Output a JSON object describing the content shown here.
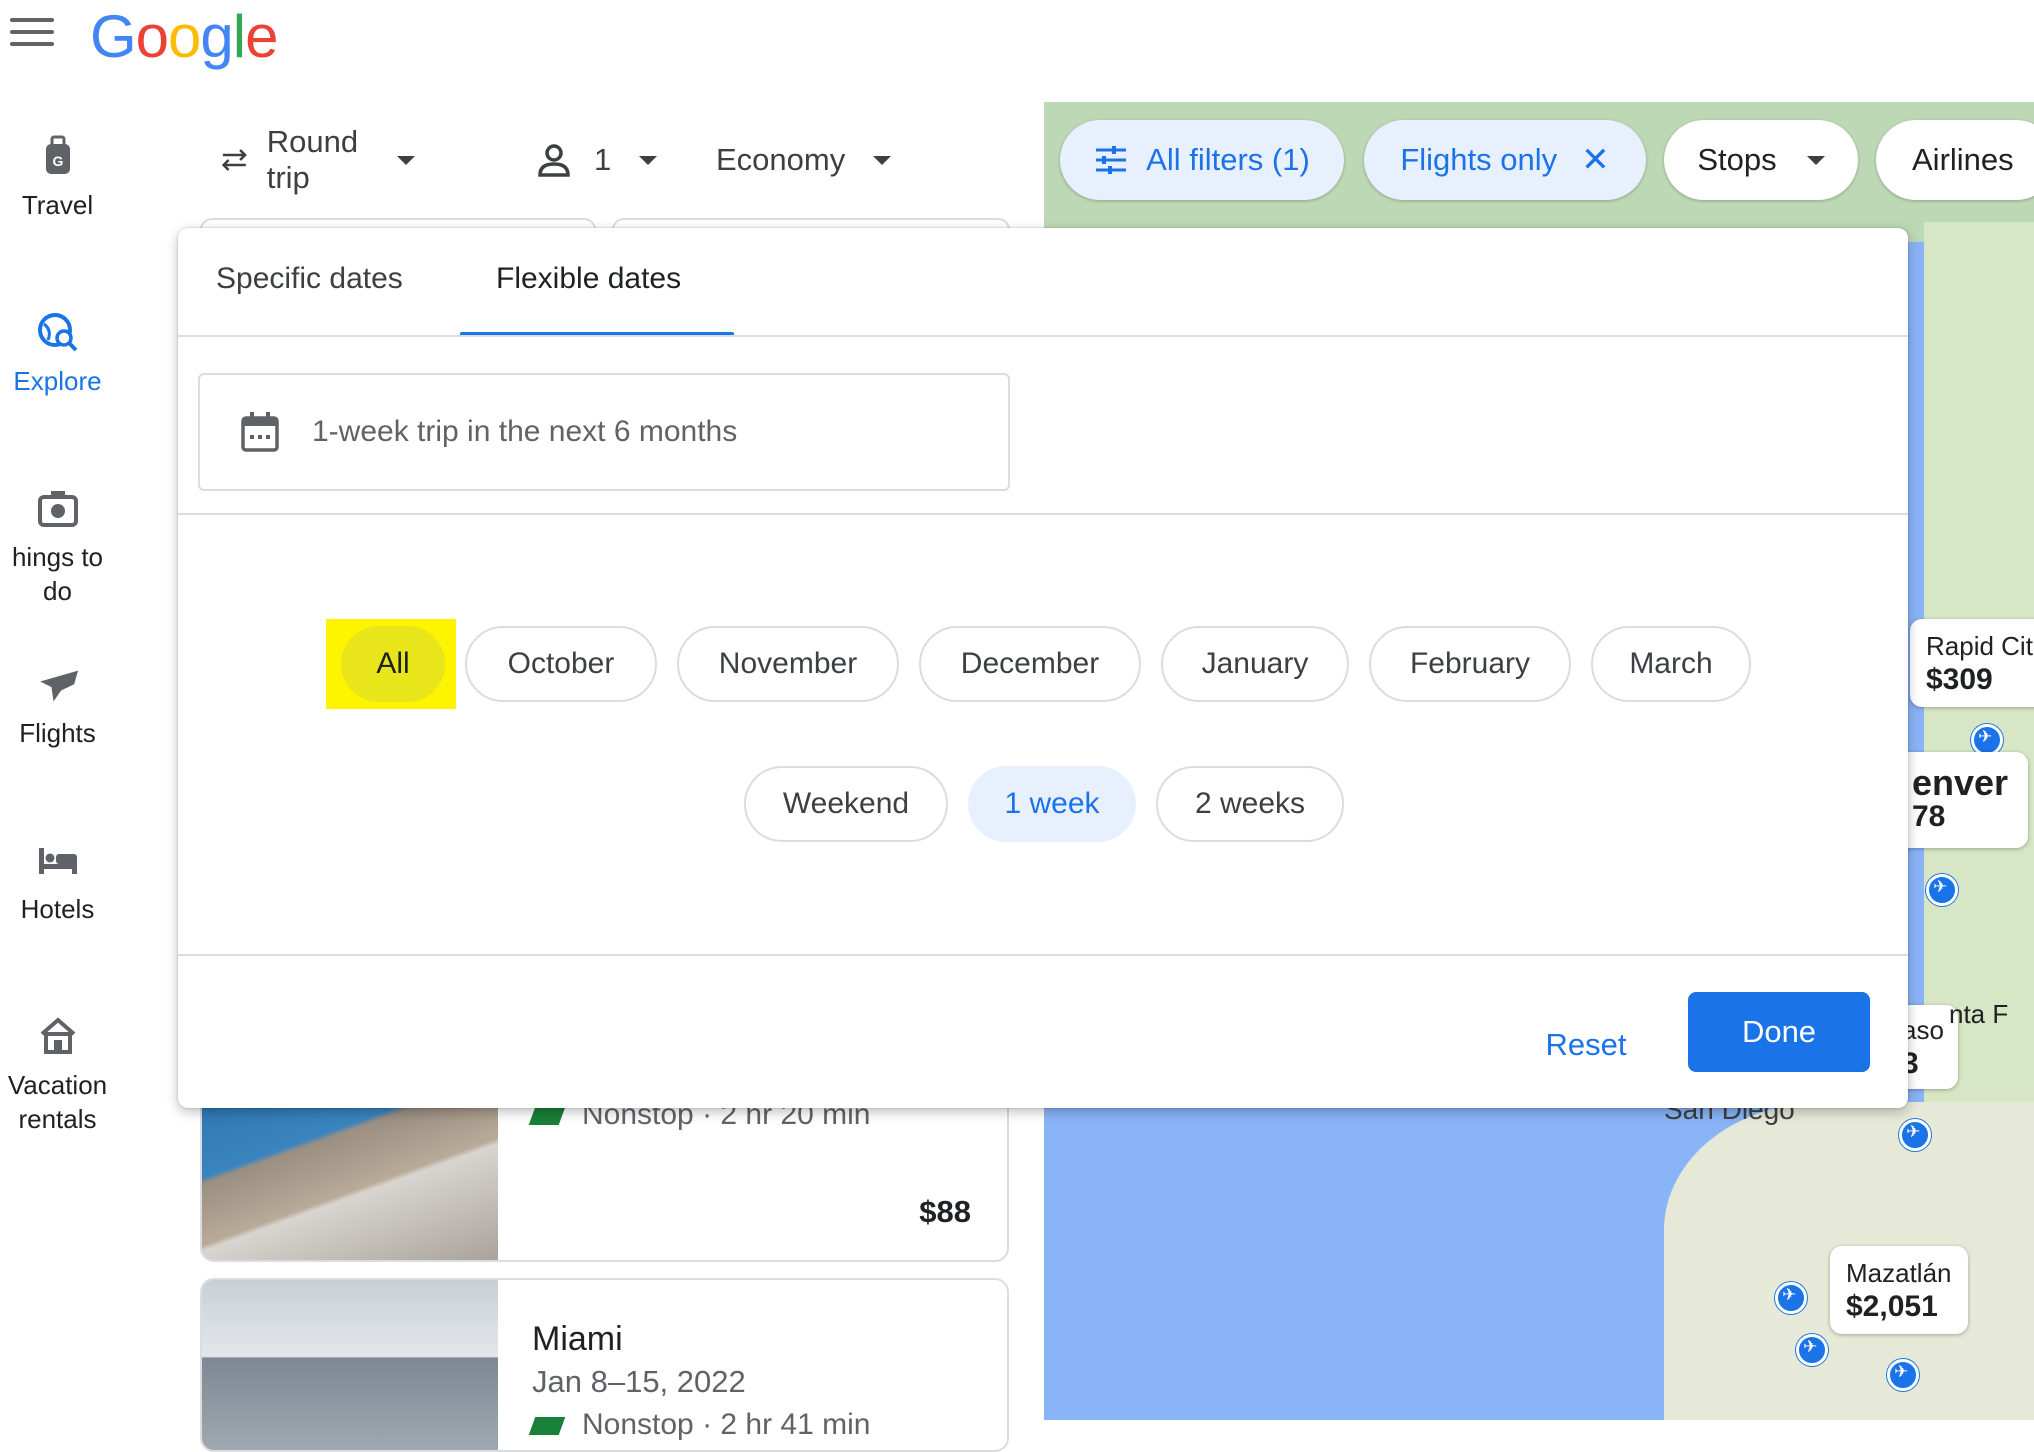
{
  "header": {
    "logo_letters": [
      "G",
      "o",
      "o",
      "g",
      "l",
      "e"
    ],
    "logo_colors": [
      "#4285f4",
      "#ea4335",
      "#fbbc05",
      "#4285f4",
      "#34a853",
      "#ea4335"
    ]
  },
  "rail": {
    "items": [
      {
        "label": "Travel",
        "icon": "luggage-icon"
      },
      {
        "label": "Explore",
        "icon": "explore-icon"
      },
      {
        "label": "hings to do",
        "icon": "camera-icon"
      },
      {
        "label": "Flights",
        "icon": "airplane-icon"
      },
      {
        "label": "Hotels",
        "icon": "bed-icon"
      },
      {
        "label_line1": "Vacation",
        "label_line2": "rentals",
        "icon": "house-icon"
      }
    ]
  },
  "search": {
    "trip_type": "Round trip",
    "passengers": "1",
    "cabin": "Economy"
  },
  "map": {
    "filters": {
      "all_filters": "All filters (1)",
      "flights_only": "Flights only",
      "stops": "Stops",
      "airlines": "Airlines"
    },
    "cards": [
      {
        "city": "Rapid Cit",
        "price": "$309"
      },
      {
        "city": "enver",
        "price": "78"
      },
      {
        "city": "aso",
        "price": "3"
      },
      {
        "city": "Mazatlán",
        "price": "$2,051"
      }
    ],
    "labels": {
      "santa_fe": "nta F",
      "san_diego": "San Diego"
    }
  },
  "results": [
    {
      "meta": "Nonstop · 2 hr 20 min",
      "price": "$88"
    },
    {
      "title": "Miami",
      "dates": "Jan 8–15, 2022",
      "meta": "Nonstop · 2 hr 41 min"
    }
  ],
  "dialog": {
    "tabs": {
      "specific": "Specific dates",
      "flexible": "Flexible dates"
    },
    "date_summary": "1-week trip in the next 6 months",
    "months": [
      "All",
      "October",
      "November",
      "December",
      "January",
      "February",
      "March"
    ],
    "durations": [
      "Weekend",
      "1 week",
      "2 weeks"
    ],
    "selected_duration": "1 week",
    "reset": "Reset",
    "done": "Done"
  },
  "colors": {
    "accent": "#1a73e8",
    "highlight": "#fff400"
  }
}
